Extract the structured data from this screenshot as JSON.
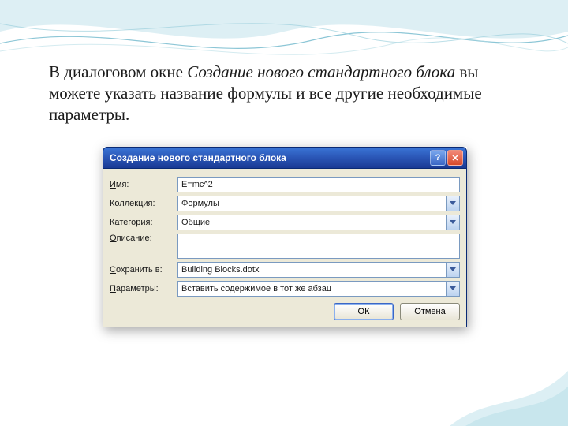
{
  "intro": {
    "prefix": "В диалоговом окне ",
    "em": "Создание нового стандартного блока",
    "suffix": " вы можете указать название формулы и все другие необходимые параметры."
  },
  "dialog": {
    "title": "Создание нового стандартного блока",
    "labels": {
      "name_u": "И",
      "name_rest": "мя:",
      "coll_u": "К",
      "coll_rest": "оллекция:",
      "cat_pre": "К",
      "cat_u": "а",
      "cat_rest": "тегория:",
      "desc_u": "О",
      "desc_rest": "писание:",
      "save_u": "С",
      "save_rest": "охранить в:",
      "opts_u": "П",
      "opts_rest": "араметры:"
    },
    "fields": {
      "name": "E=mc^2",
      "collection": "Формулы",
      "category": "Общие",
      "description": "",
      "save_in": "Building Blocks.dotx",
      "options": "Вставить содержимое в тот же абзац"
    },
    "buttons": {
      "ok": "ОК",
      "cancel": "Отмена",
      "help": "?",
      "close": "✕"
    }
  }
}
